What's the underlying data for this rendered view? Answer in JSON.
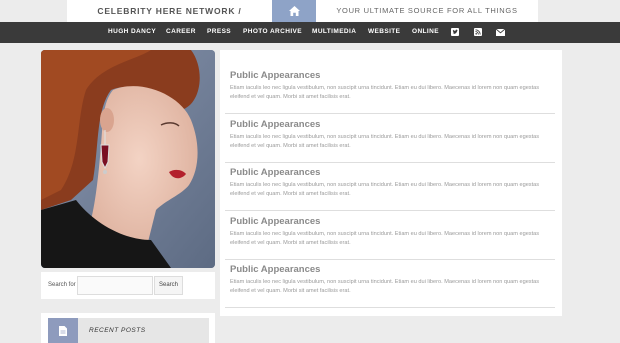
{
  "header": {
    "site_name": "CELEBRITY HERE NETWORK / CELEBRITY.COM",
    "tagline": "YOUR ULTIMATE SOURCE FOR ALL THINGS CELEBRITY NAME",
    "home_icon": "home-icon"
  },
  "nav": {
    "items": [
      "HUGH DANCY",
      "CAREER",
      "PRESS",
      "PHOTO ARCHIVE",
      "MULTIMEDIA",
      "WEBSITE",
      "ONLINE"
    ],
    "icons": [
      "twitter-icon",
      "rss-icon",
      "mail-icon"
    ]
  },
  "sidebar": {
    "photo_alt": "celebrity-portrait",
    "search_label": "Search for",
    "search_button": "Search",
    "recent_title": "RECENT POSTS"
  },
  "posts": [
    {
      "title": "Public Appearances",
      "excerpt": "Etiam iaculis leo nec ligula vestibulum, non suscipit urna tincidunt. Etiam eu dui libero. Maecenas id lorem non quam egestas eleifend et vel quam. Morbi sit amet facilisis erat."
    },
    {
      "title": "Public Appearances",
      "excerpt": "Etiam iaculis leo nec ligula vestibulum, non suscipit urna tincidunt. Etiam eu dui libero. Maecenas id lorem non quam egestas eleifend et vel quam. Morbi sit amet facilisis erat."
    },
    {
      "title": "Public Appearances",
      "excerpt": "Etiam iaculis leo nec ligula vestibulum, non suscipit urna tincidunt. Etiam eu dui libero. Maecenas id lorem non quam egestas eleifend et vel quam. Morbi sit amet facilisis erat."
    },
    {
      "title": "Public Appearances",
      "excerpt": "Etiam iaculis leo nec ligula vestibulum, non suscipit urna tincidunt. Etiam eu dui libero. Maecenas id lorem non quam egestas eleifend et vel quam. Morbi sit amet facilisis erat."
    },
    {
      "title": "Public Appearances",
      "excerpt": "Etiam iaculis leo nec ligula vestibulum, non suscipit urna tincidunt. Etiam eu dui libero. Maecenas id lorem non quam egestas eleifend et vel quam. Morbi sit amet facilisis erat."
    }
  ],
  "colors": {
    "accent": "#8ea3c7",
    "nav_bg": "#3a3a3a",
    "page_bg": "#ececec"
  }
}
